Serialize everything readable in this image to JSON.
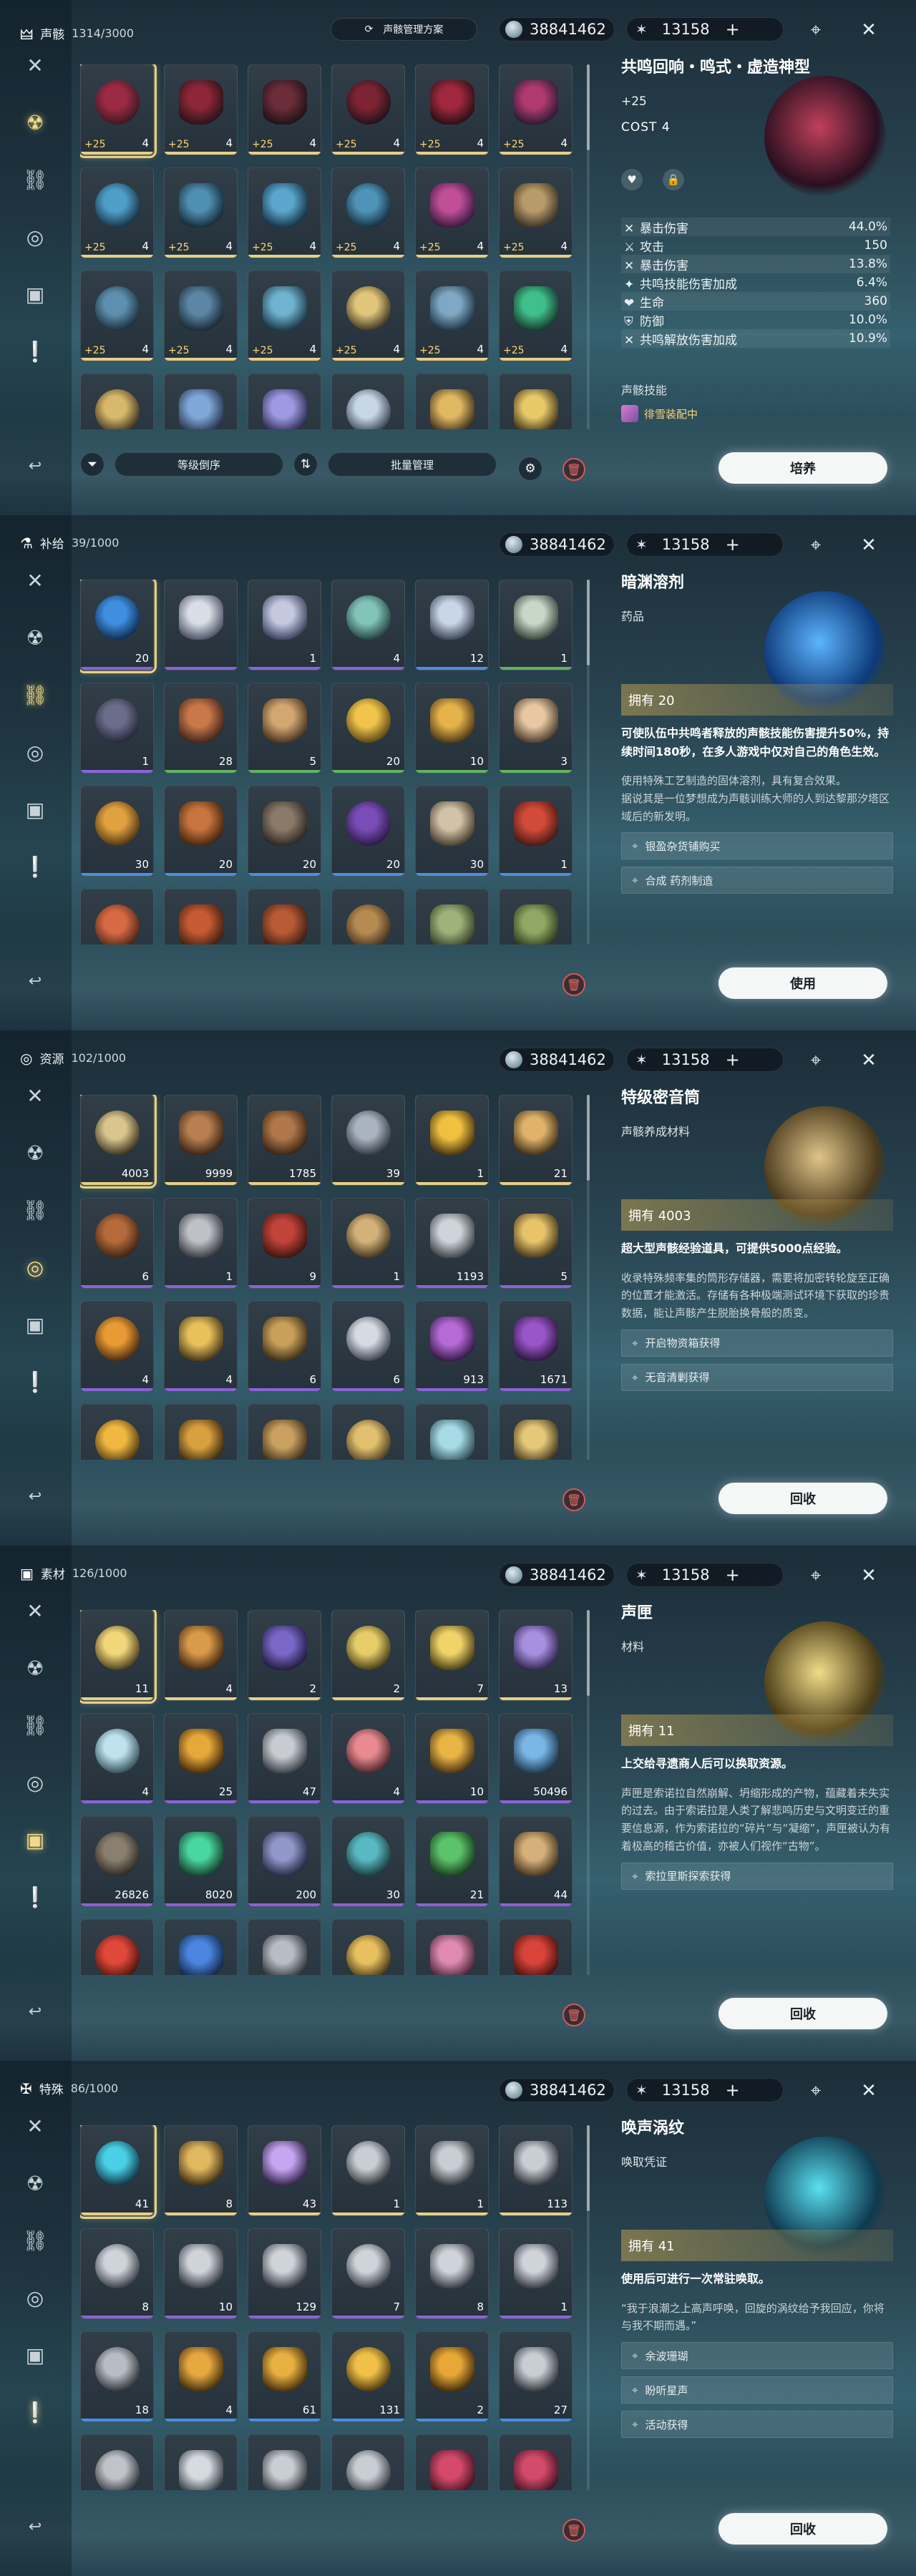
{
  "currency": {
    "shell": "38841462",
    "astrite": "13158",
    "plus": "+"
  },
  "sidebar_icons": [
    "swords-icon",
    "echo-icon",
    "link-icon",
    "resource-icon",
    "material-icon",
    "special-icon"
  ],
  "panels": [
    {
      "id": "echo",
      "header": {
        "icon": "🜲",
        "title": "声骸",
        "count": "1314/3000"
      },
      "scheme_label": "声骸管理方案",
      "active_side": 1,
      "items": [
        {
          "qty": "4",
          "lvl": "+25",
          "sel": true,
          "c1": "#9b2b45",
          "c2": "#3b1820",
          "bar": "#e7cf86"
        },
        {
          "qty": "4",
          "lvl": "+25",
          "c1": "#8d2638",
          "c2": "#2a1318",
          "bar": "#e7cf86"
        },
        {
          "qty": "4",
          "lvl": "+25",
          "c1": "#6c2c3a",
          "c2": "#1f1318",
          "bar": "#e7cf86"
        },
        {
          "qty": "4",
          "lvl": "+25",
          "c1": "#7d2434",
          "c2": "#20121a",
          "bar": "#e7cf86"
        },
        {
          "qty": "4",
          "lvl": "+25",
          "c1": "#a0283e",
          "c2": "#2b1015",
          "bar": "#e7cf86"
        },
        {
          "qty": "4",
          "lvl": "+25",
          "c1": "#b03a6d",
          "c2": "#2f1a38",
          "bar": "#e7cf86"
        },
        {
          "qty": "4",
          "lvl": "+25",
          "c1": "#4e9fc8",
          "c2": "#173245",
          "bar": "#e7cf86"
        },
        {
          "qty": "4",
          "lvl": "+25",
          "c1": "#4f8fb0",
          "c2": "#152c3a",
          "bar": "#e7cf86"
        },
        {
          "qty": "4",
          "lvl": "+25",
          "c1": "#5aa6cc",
          "c2": "#163446",
          "bar": "#e7cf86"
        },
        {
          "qty": "4",
          "lvl": "+25",
          "c1": "#4f94b8",
          "c2": "#14303f",
          "bar": "#e7cf86"
        },
        {
          "qty": "4",
          "lvl": "+25",
          "c1": "#c14e97",
          "c2": "#3a1a3f",
          "bar": "#e7cf86"
        },
        {
          "qty": "4",
          "lvl": "+25",
          "c1": "#b89b6a",
          "c2": "#3b3324",
          "bar": "#e7cf86"
        },
        {
          "qty": "4",
          "lvl": "+25",
          "c1": "#5e8fae",
          "c2": "#1b2e3c",
          "bar": "#e7cf86"
        },
        {
          "qty": "4",
          "lvl": "+25",
          "c1": "#5c86a3",
          "c2": "#1a2b38",
          "bar": "#e7cf86"
        },
        {
          "qty": "4",
          "lvl": "+25",
          "c1": "#6fb3cf",
          "c2": "#1c3948",
          "bar": "#e7cf86"
        },
        {
          "qty": "4",
          "lvl": "+25",
          "c1": "#e0c67a",
          "c2": "#3e3421",
          "bar": "#e7cf86"
        },
        {
          "qty": "4",
          "lvl": "+25",
          "c1": "#7ea8c4",
          "c2": "#213545",
          "bar": "#e7cf86"
        },
        {
          "qty": "4",
          "lvl": "+25",
          "c1": "#3fc08b",
          "c2": "#163a2d",
          "bar": "#e7cf86"
        },
        {
          "qty": "",
          "lvl": "",
          "c1": "#d8b86a",
          "c2": "#3a3020",
          "bar": ""
        },
        {
          "qty": "",
          "lvl": "",
          "c1": "#7fa8d8",
          "c2": "#2a3550",
          "bar": ""
        },
        {
          "qty": "",
          "lvl": "",
          "c1": "#9e9ae2",
          "c2": "#2d2c52",
          "bar": ""
        },
        {
          "qty": "",
          "lvl": "",
          "c1": "#c7d7e6",
          "c2": "#36414f",
          "bar": ""
        },
        {
          "qty": "",
          "lvl": "",
          "c1": "#e0b862",
          "c2": "#3f311b",
          "bar": ""
        },
        {
          "qty": "",
          "lvl": "",
          "c1": "#e8c96a",
          "c2": "#40351a",
          "bar": ""
        }
      ],
      "detail": {
        "name": "共鸣回响・鸣式・虚造神型",
        "plus": "+25",
        "cost": "COST 4",
        "stats": [
          {
            "icon": "✕",
            "label": "暴击伤害",
            "value": "44.0%"
          },
          {
            "icon": "⚔",
            "label": "攻击",
            "value": "150"
          },
          {
            "icon": "✕",
            "label": "暴击伤害",
            "value": "13.8%"
          },
          {
            "icon": "✦",
            "label": "共鸣技能伤害加成",
            "value": "6.4%"
          },
          {
            "icon": "❤",
            "label": "生命",
            "value": "360"
          },
          {
            "icon": "⛨",
            "label": "防御",
            "value": "10.0%"
          },
          {
            "icon": "✕",
            "label": "共鸣解放伤害加成",
            "value": "10.9%"
          }
        ],
        "skill_title": "声骸技能",
        "set_name": "徘雪装配中"
      },
      "bottom": {
        "sort": "等级倒序",
        "batch": "批量管理"
      },
      "action": "培养"
    },
    {
      "id": "supply",
      "header": {
        "icon": "⚗",
        "title": "补给",
        "count": "39/1000"
      },
      "active_side": 2,
      "items": [
        {
          "qty": "20",
          "sel": true,
          "c1": "#3f8fe0",
          "c2": "#0f2e55",
          "bar": "#8a63d8"
        },
        {
          "qty": "",
          "c1": "#d9dde6",
          "c2": "#4d5566",
          "bar": "#8a63d8"
        },
        {
          "qty": "1",
          "c1": "#c4c9e0",
          "c2": "#3d4460",
          "bar": "#8a63d8"
        },
        {
          "qty": "4",
          "c1": "#83c4b9",
          "c2": "#24443f",
          "bar": "#8a63d8"
        },
        {
          "qty": "12",
          "c1": "#c9d6e6",
          "c2": "#3a4656",
          "bar": "#4a8fe0"
        },
        {
          "qty": "1",
          "c1": "#c8d7c8",
          "c2": "#36463a",
          "bar": "#5fb35f"
        },
        {
          "qty": "1",
          "c1": "#6a6e8a",
          "c2": "#24263a",
          "bar": "#8a63d8"
        },
        {
          "qty": "28",
          "c1": "#c9784a",
          "c2": "#43261a",
          "bar": "#5fb35f"
        },
        {
          "qty": "5",
          "c1": "#d3a772",
          "c2": "#4b3622",
          "bar": "#5fb35f"
        },
        {
          "qty": "20",
          "c1": "#f1c54b",
          "c2": "#5a4515",
          "bar": "#5fb35f"
        },
        {
          "qty": "10",
          "c1": "#e6b34a",
          "c2": "#4f3a16",
          "bar": "#5fb35f"
        },
        {
          "qty": "3",
          "c1": "#e8c8a2",
          "c2": "#4d3d2e",
          "bar": "#5fb35f"
        },
        {
          "qty": "30",
          "c1": "#e0a23f",
          "c2": "#4e3314",
          "bar": "#4a8fe0"
        },
        {
          "qty": "20",
          "c1": "#c7743e",
          "c2": "#46260f",
          "bar": "#4a8fe0"
        },
        {
          "qty": "20",
          "c1": "#8a7a6a",
          "c2": "#2e2822",
          "bar": "#4a8fe0"
        },
        {
          "qty": "20",
          "c1": "#7a4cb8",
          "c2": "#2a1a44",
          "bar": "#4a8fe0"
        },
        {
          "qty": "30",
          "c1": "#d2c3a8",
          "c2": "#473f30",
          "bar": "#4a8fe0"
        },
        {
          "qty": "1",
          "c1": "#d24a3a",
          "c2": "#4a1a14",
          "bar": "#4a8fe0"
        },
        {
          "qty": "",
          "c1": "#d76a44",
          "c2": "#4a2414",
          "bar": ""
        },
        {
          "qty": "",
          "c1": "#c65a33",
          "c2": "#45200f",
          "bar": ""
        },
        {
          "qty": "",
          "c1": "#b85a35",
          "c2": "#401f12",
          "bar": ""
        },
        {
          "qty": "",
          "c1": "#b78a52",
          "c2": "#3e2f1c",
          "bar": ""
        },
        {
          "qty": "",
          "c1": "#9fb27a",
          "c2": "#334027",
          "bar": ""
        },
        {
          "qty": "",
          "c1": "#8fa864",
          "c2": "#2d3a1f",
          "bar": ""
        }
      ],
      "detail": {
        "name": "暗渊溶剂",
        "type": "药品",
        "owned": "拥有 20",
        "strong": "可使队伍中共鸣者释放的声骸技能伤害提升50%，持续时间180秒，在多人游戏中仅对自己的角色生效。",
        "norm": "使用特殊工艺制造的固体溶剂，具有复合效果。\n据说其是一位梦想成为声骸训练大师的人到达黎那汐塔区域后的新发明。",
        "sources": [
          "银盈杂货铺购买",
          "合成 药剂制造"
        ],
        "art_c1": "#5db4ff",
        "art_c2": "#0d3a7a"
      },
      "action": "使用"
    },
    {
      "id": "resource",
      "header": {
        "icon": "◎",
        "title": "资源",
        "count": "102/1000"
      },
      "active_side": 3,
      "items": [
        {
          "qty": "4003",
          "sel": true,
          "c1": "#d9c58e",
          "c2": "#3c3420",
          "bar": "#e7cf86"
        },
        {
          "qty": "9999",
          "c1": "#b88050",
          "c2": "#3b2617",
          "bar": "#e7cf86"
        },
        {
          "qty": "1785",
          "c1": "#b0784a",
          "c2": "#3a2515",
          "bar": "#e7cf86"
        },
        {
          "qty": "39",
          "c1": "#aab3c0",
          "c2": "#333a44",
          "bar": "#e7cf86"
        },
        {
          "qty": "1",
          "c1": "#f0c040",
          "c2": "#4a3610",
          "bar": "#e7cf86"
        },
        {
          "qty": "21",
          "c1": "#e0b36a",
          "c2": "#42321a",
          "bar": "#e7cf86"
        },
        {
          "qty": "6",
          "c1": "#b46a3a",
          "c2": "#3d2214",
          "bar": "#8a63d8"
        },
        {
          "qty": "1",
          "c1": "#c0c0c8",
          "c2": "#3a3a42",
          "bar": "#8a63d8"
        },
        {
          "qty": "9",
          "c1": "#c2433a",
          "c2": "#40150f",
          "bar": "#8a63d8"
        },
        {
          "qty": "1",
          "c1": "#d3b27a",
          "c2": "#43351e",
          "bar": "#8a63d8"
        },
        {
          "qty": "1193",
          "c1": "#cfd3da",
          "c2": "#3f434a",
          "bar": "#8a63d8"
        },
        {
          "qty": "5",
          "c1": "#e7c36a",
          "c2": "#463a1c",
          "bar": "#8a63d8"
        },
        {
          "qty": "4",
          "c1": "#e89a35",
          "c2": "#4a2a0e",
          "bar": "#8a63d8"
        },
        {
          "qty": "4",
          "c1": "#e9c15a",
          "c2": "#47381a",
          "bar": "#8a63d8"
        },
        {
          "qty": "6",
          "c1": "#c9a05a",
          "c2": "#3f301a",
          "bar": "#8a63d8"
        },
        {
          "qty": "6",
          "c1": "#d6dbe2",
          "c2": "#3d4350",
          "bar": "#8a63d8"
        },
        {
          "qty": "913",
          "c1": "#b56ad6",
          "c2": "#361a48",
          "bar": "#8a63d8"
        },
        {
          "qty": "1671",
          "c1": "#9a55c8",
          "c2": "#2e1842",
          "bar": "#8a63d8"
        },
        {
          "qty": "",
          "c1": "#f0b840",
          "c2": "#4a3410",
          "bar": ""
        },
        {
          "qty": "",
          "c1": "#d9a040",
          "c2": "#3e2c0e",
          "bar": ""
        },
        {
          "qty": "",
          "c1": "#c9a060",
          "c2": "#3e301c",
          "bar": ""
        },
        {
          "qty": "",
          "c1": "#e3c070",
          "c2": "#463a1e",
          "bar": ""
        },
        {
          "qty": "",
          "c1": "#a6dbe6",
          "c2": "#2e4d56",
          "bar": ""
        },
        {
          "qty": "",
          "c1": "#e6c878",
          "c2": "#44391f",
          "bar": ""
        }
      ],
      "detail": {
        "name": "特级密音筒",
        "type": "声骸养成材料",
        "owned": "拥有 4003",
        "strong": "超大型声骸经验道具，可提供5000点经验。",
        "norm": "收录特殊频率集的筒形存储器，需要将加密转轮旋至正确的位置才能激活。存储有各种极端测试环境下获取的珍贵数据，能让声骸产生脱胎换骨般的质变。",
        "sources": [
          "开启物资箱获得",
          "无音清剿获得"
        ],
        "art_c1": "#e0c48a",
        "art_c2": "#4a3a1c"
      },
      "action": "回收"
    },
    {
      "id": "material",
      "header": {
        "icon": "▣",
        "title": "素材",
        "count": "126/1000"
      },
      "active_side": 4,
      "items": [
        {
          "qty": "11",
          "sel": true,
          "c1": "#f1d77a",
          "c2": "#4a3e1a",
          "bar": "#e7cf86"
        },
        {
          "qty": "4",
          "c1": "#d99a4a",
          "c2": "#452a12",
          "bar": "#e7cf86"
        },
        {
          "qty": "2",
          "c1": "#7a68c8",
          "c2": "#221c44",
          "bar": "#e7cf86"
        },
        {
          "qty": "2",
          "c1": "#e6cd6a",
          "c2": "#453b16",
          "bar": "#e7cf86"
        },
        {
          "qty": "7",
          "c1": "#f0d46a",
          "c2": "#4a3e14",
          "bar": "#e7cf86"
        },
        {
          "qty": "13",
          "c1": "#a890e0",
          "c2": "#30264e",
          "bar": "#e7cf86"
        },
        {
          "qty": "4",
          "c1": "#bfe2ee",
          "c2": "#35505a",
          "bar": "#8a63d8"
        },
        {
          "qty": "25",
          "c1": "#e6a83a",
          "c2": "#4a2e0c",
          "bar": "#8a63d8"
        },
        {
          "qty": "47",
          "c1": "#c8ccd2",
          "c2": "#3c4048",
          "bar": "#8a63d8"
        },
        {
          "qty": "4",
          "c1": "#e88a90",
          "c2": "#4a2428",
          "bar": "#8a63d8"
        },
        {
          "qty": "10",
          "c1": "#e9b446",
          "c2": "#4a3412",
          "bar": "#8a63d8"
        },
        {
          "qty": "50496",
          "c1": "#7ab6e6",
          "c2": "#1f3a52",
          "bar": "#8a63d8"
        },
        {
          "qty": "26826",
          "c1": "#8a8070",
          "c2": "#2c2822",
          "bar": "#8a63d8"
        },
        {
          "qty": "8020",
          "c1": "#4ad6a0",
          "c2": "#14402e",
          "bar": "#8a63d8"
        },
        {
          "qty": "200",
          "c1": "#8f98c8",
          "c2": "#262a44",
          "bar": "#8a63d8"
        },
        {
          "qty": "30",
          "c1": "#5ab8c0",
          "c2": "#183a3e",
          "bar": "#8a63d8"
        },
        {
          "qty": "21",
          "c1": "#5cc36a",
          "c2": "#183e1e",
          "bar": "#8a63d8"
        },
        {
          "qty": "44",
          "c1": "#d6b07a",
          "c2": "#45361f",
          "bar": "#8a63d8"
        },
        {
          "qty": "",
          "c1": "#e0483a",
          "c2": "#4a120c",
          "bar": ""
        },
        {
          "qty": "",
          "c1": "#4a86e0",
          "c2": "#13284a",
          "bar": ""
        },
        {
          "qty": "",
          "c1": "#b8bcc4",
          "c2": "#34383e",
          "bar": ""
        },
        {
          "qty": "",
          "c1": "#e8c060",
          "c2": "#453616",
          "bar": ""
        },
        {
          "qty": "",
          "c1": "#e08ab0",
          "c2": "#48253a",
          "bar": ""
        },
        {
          "qty": "",
          "c1": "#d8443a",
          "c2": "#48120e",
          "bar": ""
        }
      ],
      "detail": {
        "name": "声匣",
        "type": "材料",
        "owned": "拥有 11",
        "strong": "上交给寻遗商人后可以换取资源。",
        "norm": "声匣是索诺拉自然崩解、坍缩形成的产物，蕴藏着未失实的过去。由于索诺拉是人类了解悲鸣历史与文明变迁的重要信息源，作为索诺拉的“碎片”与“凝缩”，声匣被认为有着极高的稽古价值，亦被人们视作“古物”。",
        "sources": [
          "索拉里斯探索获得"
        ],
        "art_c1": "#f2dc8a",
        "art_c2": "#4a3c16"
      },
      "action": "回收"
    },
    {
      "id": "special",
      "header": {
        "icon": "✠",
        "title": "特殊",
        "count": "86/1000"
      },
      "active_side": 5,
      "items": [
        {
          "qty": "41",
          "sel": true,
          "c1": "#4ad0e6",
          "c2": "#10384a",
          "bar": "#e7cf86"
        },
        {
          "qty": "8",
          "c1": "#e0b860",
          "c2": "#433214",
          "bar": "#e7cf86"
        },
        {
          "qty": "43",
          "c1": "#c6a6f0",
          "c2": "#352650",
          "bar": "#e7cf86"
        },
        {
          "qty": "1",
          "c1": "#c9cdd4",
          "c2": "#34383e",
          "bar": "#e7cf86"
        },
        {
          "qty": "1",
          "c1": "#c9cdd4",
          "c2": "#34383e",
          "bar": "#e7cf86"
        },
        {
          "qty": "113",
          "c1": "#c9cdd4",
          "c2": "#34383e",
          "bar": "#e7cf86"
        },
        {
          "qty": "8",
          "c1": "#cfd3da",
          "c2": "#383c44",
          "bar": "#8a63d8"
        },
        {
          "qty": "10",
          "c1": "#cfd3da",
          "c2": "#383c44",
          "bar": "#8a63d8"
        },
        {
          "qty": "129",
          "c1": "#cfd3da",
          "c2": "#383c44",
          "bar": "#8a63d8"
        },
        {
          "qty": "7",
          "c1": "#cfd3da",
          "c2": "#383c44",
          "bar": "#8a63d8"
        },
        {
          "qty": "8",
          "c1": "#cfd3da",
          "c2": "#383c44",
          "bar": "#8a63d8"
        },
        {
          "qty": "1",
          "c1": "#cfd3da",
          "c2": "#383c44",
          "bar": "#8a63d8"
        },
        {
          "qty": "18",
          "c1": "#b8bcc4",
          "c2": "#2f3238",
          "bar": "#4a8fe0"
        },
        {
          "qty": "4",
          "c1": "#e8a840",
          "c2": "#45300e",
          "bar": "#4a8fe0"
        },
        {
          "qty": "61",
          "c1": "#e8b040",
          "c2": "#48320e",
          "bar": "#4a8fe0"
        },
        {
          "qty": "131",
          "c1": "#f0c048",
          "c2": "#4a3610",
          "bar": "#4a8fe0"
        },
        {
          "qty": "2",
          "c1": "#e8a838",
          "c2": "#452e0c",
          "bar": "#4a8fe0"
        },
        {
          "qty": "27",
          "c1": "#c9cdd4",
          "c2": "#34383e",
          "bar": "#4a8fe0"
        },
        {
          "qty": "",
          "c1": "#c0c4ca",
          "c2": "#30343a",
          "bar": ""
        },
        {
          "qty": "",
          "c1": "#d6dbe2",
          "c2": "#3a3f46",
          "bar": ""
        },
        {
          "qty": "",
          "c1": "#c9cdd4",
          "c2": "#34383e",
          "bar": ""
        },
        {
          "qty": "",
          "c1": "#c9cdd4",
          "c2": "#34383e",
          "bar": ""
        },
        {
          "qty": "",
          "c1": "#d44a6a",
          "c2": "#461424",
          "bar": ""
        },
        {
          "qty": "",
          "c1": "#d44a6a",
          "c2": "#461424",
          "bar": ""
        }
      ],
      "detail": {
        "name": "唤声涡纹",
        "type": "唤取凭证",
        "owned": "拥有 41",
        "strong": "使用后可进行一次常驻唤取。",
        "norm": "“我于浪潮之上高声呼唤，回旋的涡纹给予我回应，你将与我不期而遇。”",
        "sources": [
          "余波珊瑚",
          "盼听星声",
          "活动获得"
        ],
        "art_c1": "#5ae0f0",
        "art_c2": "#0f3a50"
      },
      "action": "回收"
    }
  ]
}
